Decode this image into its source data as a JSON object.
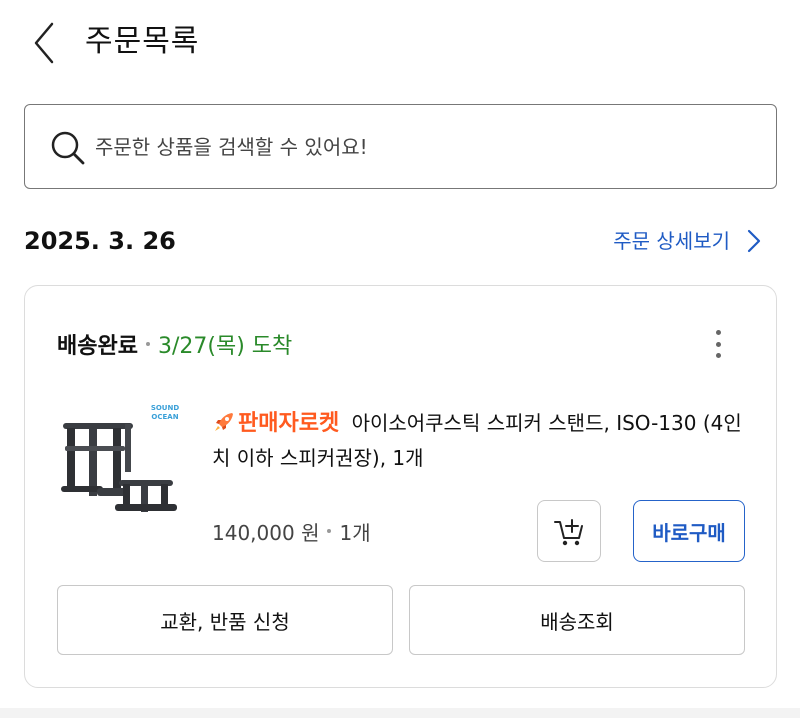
{
  "header": {
    "title": "주문목록"
  },
  "search": {
    "placeholder": "주문한 상품을 검색할 수 있어요!"
  },
  "order": {
    "date": "2025. 3. 26",
    "detail_link": "주문 상세보기",
    "status": "배송완료",
    "arrival": "3/27(목) 도착",
    "seller_badge": "판매자로켓",
    "product_name": "아이소어쿠스틱 스피커 스탠드, ISO-130 (4인치 이하 스피커권장), 1개",
    "thumbnail_brand": "SOUND OCEAN",
    "price": "140,000 원",
    "quantity": "1개",
    "buy_now_label": "바로구매",
    "exchange_label": "교환, 반품 신청",
    "delivery_label": "배송조회"
  },
  "colors": {
    "accent_blue": "#1f5bc4",
    "arrival_green": "#2a8a2a",
    "rocket_orange": "#ff5a1f"
  },
  "icons": [
    "back-chevron-icon",
    "search-icon",
    "chevron-right-icon",
    "more-vertical-icon",
    "rocket-icon",
    "add-to-cart-icon"
  ]
}
